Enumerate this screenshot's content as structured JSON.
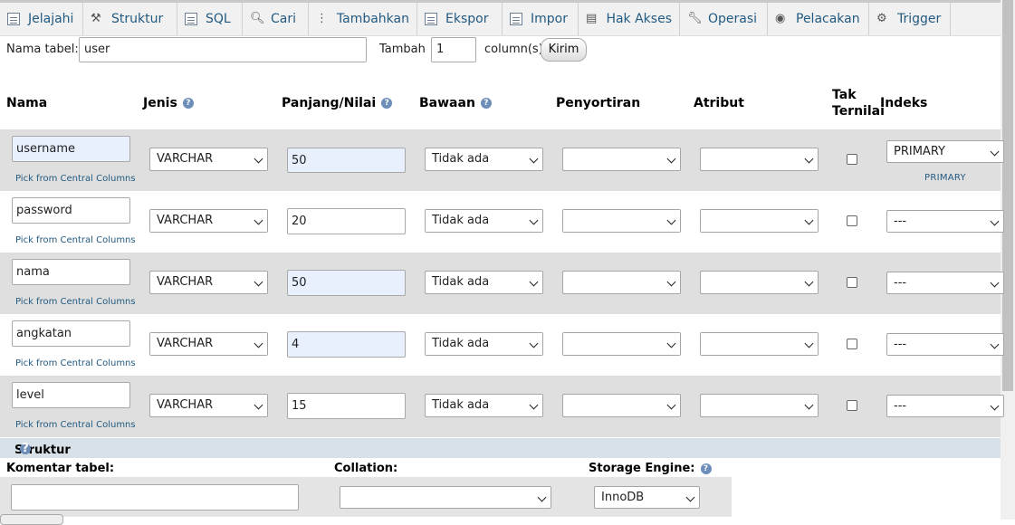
{
  "tabs": [
    {
      "label": "Jelajahi",
      "icon": "browse-icon"
    },
    {
      "label": "Struktur",
      "icon": "structure-icon"
    },
    {
      "label": "SQL",
      "icon": "sql-icon"
    },
    {
      "label": "Cari",
      "icon": "search-icon"
    },
    {
      "label": "Tambahkan",
      "icon": "insert-icon"
    },
    {
      "label": "Ekspor",
      "icon": "export-icon"
    },
    {
      "label": "Impor",
      "icon": "import-icon"
    },
    {
      "label": "Hak Akses",
      "icon": "privileges-icon"
    },
    {
      "label": "Operasi",
      "icon": "wrench-icon"
    },
    {
      "label": "Pelacakan",
      "icon": "eye-icon"
    },
    {
      "label": "Trigger",
      "icon": "trigger-icon"
    }
  ],
  "table_name": {
    "label": "Nama tabel:",
    "value": "user"
  },
  "add_columns": {
    "label": "Tambah",
    "value": "1",
    "suffix": "column(s)",
    "button": "Kirim"
  },
  "headers": {
    "name": "Nama",
    "type": "Jenis",
    "length": "Panjang/Nilai",
    "default": "Bawaan",
    "collation": "Penyortiran",
    "attributes": "Atribut",
    "null_line1": "Tak",
    "null_line2": "Ternilai",
    "index": "Indeks"
  },
  "pick_label": "Pick from Central Columns",
  "columns": [
    {
      "name": "username",
      "type": "VARCHAR",
      "length": "50",
      "default": "Tidak ada",
      "collation": "",
      "attribute": "",
      "null": false,
      "index": "PRIMARY",
      "index_note": "PRIMARY"
    },
    {
      "name": "password",
      "type": "VARCHAR",
      "length": "20",
      "default": "Tidak ada",
      "collation": "",
      "attribute": "",
      "null": false,
      "index": "---",
      "index_note": ""
    },
    {
      "name": "nama",
      "type": "VARCHAR",
      "length": "50",
      "default": "Tidak ada",
      "collation": "",
      "attribute": "",
      "null": false,
      "index": "---",
      "index_note": ""
    },
    {
      "name": "angkatan",
      "type": "VARCHAR",
      "length": "4",
      "default": "Tidak ada",
      "collation": "",
      "attribute": "",
      "null": false,
      "index": "---",
      "index_note": ""
    },
    {
      "name": "level",
      "type": "VARCHAR",
      "length": "15",
      "default": "Tidak ada",
      "collation": "",
      "attribute": "",
      "null": false,
      "index": "---",
      "index_note": ""
    }
  ],
  "structure": {
    "title": "Struktur",
    "comment_label": "Komentar tabel:",
    "comment_value": "",
    "collation_label": "Collation:",
    "collation_value": "",
    "engine_label": "Storage Engine:",
    "engine_value": "InnoDB"
  },
  "colors": {
    "tab_text": "#235a81",
    "row_shade": "#dfdfdf",
    "highlight_input": "#e8f0fe",
    "struktur_bar": "#d8e0e8"
  }
}
